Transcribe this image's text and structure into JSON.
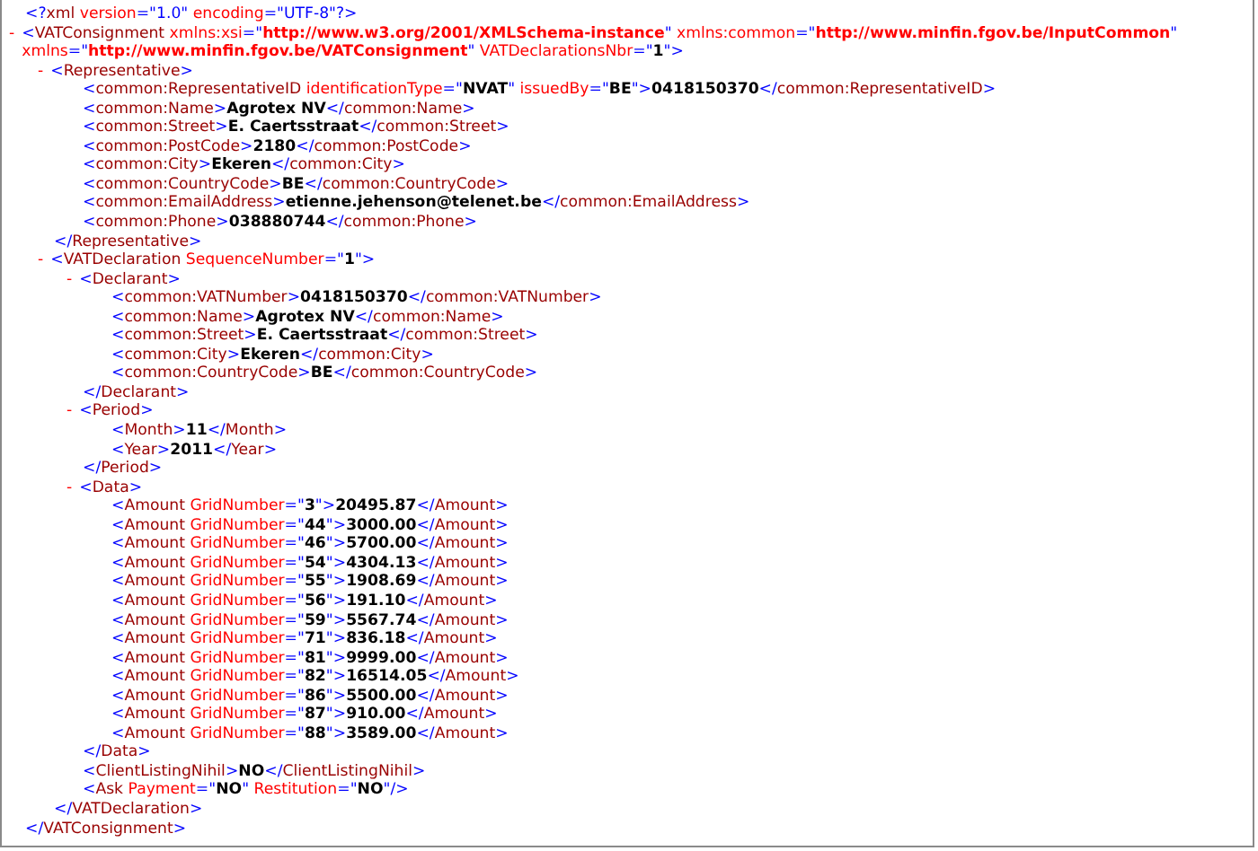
{
  "declaration": [
    {
      "kind": "p",
      "text": "<?"
    },
    {
      "kind": "n",
      "text": "xml"
    },
    {
      "kind": "a",
      "text": " version"
    },
    {
      "kind": "p",
      "text": "=\"1.0\""
    },
    {
      "kind": "a",
      "text": " encoding"
    },
    {
      "kind": "p",
      "text": "=\"UTF-8\"?>"
    }
  ],
  "root": {
    "kind": "branch",
    "toggle": "-",
    "expanded": true,
    "open": [
      {
        "kind": "p",
        "text": "<"
      },
      {
        "kind": "n",
        "text": "VATConsignment"
      },
      {
        "kind": "a",
        "text": " xmlns:xsi"
      },
      {
        "kind": "p",
        "text": "=\""
      },
      {
        "kind": "x",
        "text": "http://www.w3.org/2001/XMLSchema-instance"
      },
      {
        "kind": "p",
        "text": "\""
      },
      {
        "kind": "a",
        "text": " xmlns:common"
      },
      {
        "kind": "p",
        "text": "=\""
      },
      {
        "kind": "x",
        "text": "http://www.minfin.fgov.be/InputCommon"
      },
      {
        "kind": "p",
        "text": "\""
      },
      {
        "kind": "a",
        "text": " xmlns"
      },
      {
        "kind": "p",
        "text": "=\""
      },
      {
        "kind": "x",
        "text": "http://www.minfin.fgov.be/VATConsignment"
      },
      {
        "kind": "p",
        "text": "\""
      },
      {
        "kind": "a",
        "text": " VATDeclarationsNbr"
      },
      {
        "kind": "p",
        "text": "=\""
      },
      {
        "kind": "v",
        "text": "1"
      },
      {
        "kind": "p",
        "text": "\">"
      }
    ],
    "children": [
      {
        "kind": "branch",
        "toggle": "-",
        "expanded": true,
        "open": [
          {
            "kind": "p",
            "text": "<"
          },
          {
            "kind": "n",
            "text": "Representative"
          },
          {
            "kind": "p",
            "text": ">"
          }
        ],
        "children": [
          {
            "kind": "leaf",
            "line": [
              {
                "kind": "p",
                "text": "<"
              },
              {
                "kind": "n",
                "text": "common:RepresentativeID"
              },
              {
                "kind": "a",
                "text": " identificationType"
              },
              {
                "kind": "p",
                "text": "=\""
              },
              {
                "kind": "v",
                "text": "NVAT"
              },
              {
                "kind": "p",
                "text": "\""
              },
              {
                "kind": "a",
                "text": " issuedBy"
              },
              {
                "kind": "p",
                "text": "=\""
              },
              {
                "kind": "v",
                "text": "BE"
              },
              {
                "kind": "p",
                "text": "\">"
              },
              {
                "kind": "t",
                "text": "0418150370"
              },
              {
                "kind": "p",
                "text": "</"
              },
              {
                "kind": "n",
                "text": "common:RepresentativeID"
              },
              {
                "kind": "p",
                "text": ">"
              }
            ]
          },
          {
            "kind": "leaf",
            "line": [
              {
                "kind": "p",
                "text": "<"
              },
              {
                "kind": "n",
                "text": "common:Name"
              },
              {
                "kind": "p",
                "text": ">"
              },
              {
                "kind": "t",
                "text": "Agrotex NV"
              },
              {
                "kind": "p",
                "text": "</"
              },
              {
                "kind": "n",
                "text": "common:Name"
              },
              {
                "kind": "p",
                "text": ">"
              }
            ]
          },
          {
            "kind": "leaf",
            "line": [
              {
                "kind": "p",
                "text": "<"
              },
              {
                "kind": "n",
                "text": "common:Street"
              },
              {
                "kind": "p",
                "text": ">"
              },
              {
                "kind": "t",
                "text": "E. Caertsstraat"
              },
              {
                "kind": "p",
                "text": "</"
              },
              {
                "kind": "n",
                "text": "common:Street"
              },
              {
                "kind": "p",
                "text": ">"
              }
            ]
          },
          {
            "kind": "leaf",
            "line": [
              {
                "kind": "p",
                "text": "<"
              },
              {
                "kind": "n",
                "text": "common:PostCode"
              },
              {
                "kind": "p",
                "text": ">"
              },
              {
                "kind": "t",
                "text": "2180"
              },
              {
                "kind": "p",
                "text": "</"
              },
              {
                "kind": "n",
                "text": "common:PostCode"
              },
              {
                "kind": "p",
                "text": ">"
              }
            ]
          },
          {
            "kind": "leaf",
            "line": [
              {
                "kind": "p",
                "text": "<"
              },
              {
                "kind": "n",
                "text": "common:City"
              },
              {
                "kind": "p",
                "text": ">"
              },
              {
                "kind": "t",
                "text": "Ekeren"
              },
              {
                "kind": "p",
                "text": "</"
              },
              {
                "kind": "n",
                "text": "common:City"
              },
              {
                "kind": "p",
                "text": ">"
              }
            ]
          },
          {
            "kind": "leaf",
            "line": [
              {
                "kind": "p",
                "text": "<"
              },
              {
                "kind": "n",
                "text": "common:CountryCode"
              },
              {
                "kind": "p",
                "text": ">"
              },
              {
                "kind": "t",
                "text": "BE"
              },
              {
                "kind": "p",
                "text": "</"
              },
              {
                "kind": "n",
                "text": "common:CountryCode"
              },
              {
                "kind": "p",
                "text": ">"
              }
            ]
          },
          {
            "kind": "leaf",
            "line": [
              {
                "kind": "p",
                "text": "<"
              },
              {
                "kind": "n",
                "text": "common:EmailAddress"
              },
              {
                "kind": "p",
                "text": ">"
              },
              {
                "kind": "t",
                "text": "etienne.jehenson@telenet.be"
              },
              {
                "kind": "p",
                "text": "</"
              },
              {
                "kind": "n",
                "text": "common:EmailAddress"
              },
              {
                "kind": "p",
                "text": ">"
              }
            ]
          },
          {
            "kind": "leaf",
            "line": [
              {
                "kind": "p",
                "text": "<"
              },
              {
                "kind": "n",
                "text": "common:Phone"
              },
              {
                "kind": "p",
                "text": ">"
              },
              {
                "kind": "t",
                "text": "038880744"
              },
              {
                "kind": "p",
                "text": "</"
              },
              {
                "kind": "n",
                "text": "common:Phone"
              },
              {
                "kind": "p",
                "text": ">"
              }
            ]
          }
        ],
        "close": [
          {
            "kind": "p",
            "text": "</"
          },
          {
            "kind": "n",
            "text": "Representative"
          },
          {
            "kind": "p",
            "text": ">"
          }
        ]
      },
      {
        "kind": "branch",
        "toggle": "-",
        "expanded": true,
        "open": [
          {
            "kind": "p",
            "text": "<"
          },
          {
            "kind": "n",
            "text": "VATDeclaration"
          },
          {
            "kind": "a",
            "text": " SequenceNumber"
          },
          {
            "kind": "p",
            "text": "=\""
          },
          {
            "kind": "v",
            "text": "1"
          },
          {
            "kind": "p",
            "text": "\">"
          }
        ],
        "children": [
          {
            "kind": "branch",
            "toggle": "-",
            "expanded": true,
            "open": [
              {
                "kind": "p",
                "text": "<"
              },
              {
                "kind": "n",
                "text": "Declarant"
              },
              {
                "kind": "p",
                "text": ">"
              }
            ],
            "children": [
              {
                "kind": "leaf",
                "line": [
                  {
                    "kind": "p",
                    "text": "<"
                  },
                  {
                    "kind": "n",
                    "text": "common:VATNumber"
                  },
                  {
                    "kind": "p",
                    "text": ">"
                  },
                  {
                    "kind": "t",
                    "text": "0418150370"
                  },
                  {
                    "kind": "p",
                    "text": "</"
                  },
                  {
                    "kind": "n",
                    "text": "common:VATNumber"
                  },
                  {
                    "kind": "p",
                    "text": ">"
                  }
                ]
              },
              {
                "kind": "leaf",
                "line": [
                  {
                    "kind": "p",
                    "text": "<"
                  },
                  {
                    "kind": "n",
                    "text": "common:Name"
                  },
                  {
                    "kind": "p",
                    "text": ">"
                  },
                  {
                    "kind": "t",
                    "text": "Agrotex NV"
                  },
                  {
                    "kind": "p",
                    "text": "</"
                  },
                  {
                    "kind": "n",
                    "text": "common:Name"
                  },
                  {
                    "kind": "p",
                    "text": ">"
                  }
                ]
              },
              {
                "kind": "leaf",
                "line": [
                  {
                    "kind": "p",
                    "text": "<"
                  },
                  {
                    "kind": "n",
                    "text": "common:Street"
                  },
                  {
                    "kind": "p",
                    "text": ">"
                  },
                  {
                    "kind": "t",
                    "text": "E. Caertsstraat"
                  },
                  {
                    "kind": "p",
                    "text": "</"
                  },
                  {
                    "kind": "n",
                    "text": "common:Street"
                  },
                  {
                    "kind": "p",
                    "text": ">"
                  }
                ]
              },
              {
                "kind": "leaf",
                "line": [
                  {
                    "kind": "p",
                    "text": "<"
                  },
                  {
                    "kind": "n",
                    "text": "common:City"
                  },
                  {
                    "kind": "p",
                    "text": ">"
                  },
                  {
                    "kind": "t",
                    "text": "Ekeren"
                  },
                  {
                    "kind": "p",
                    "text": "</"
                  },
                  {
                    "kind": "n",
                    "text": "common:City"
                  },
                  {
                    "kind": "p",
                    "text": ">"
                  }
                ]
              },
              {
                "kind": "leaf",
                "line": [
                  {
                    "kind": "p",
                    "text": "<"
                  },
                  {
                    "kind": "n",
                    "text": "common:CountryCode"
                  },
                  {
                    "kind": "p",
                    "text": ">"
                  },
                  {
                    "kind": "t",
                    "text": "BE"
                  },
                  {
                    "kind": "p",
                    "text": "</"
                  },
                  {
                    "kind": "n",
                    "text": "common:CountryCode"
                  },
                  {
                    "kind": "p",
                    "text": ">"
                  }
                ]
              }
            ],
            "close": [
              {
                "kind": "p",
                "text": "</"
              },
              {
                "kind": "n",
                "text": "Declarant"
              },
              {
                "kind": "p",
                "text": ">"
              }
            ]
          },
          {
            "kind": "branch",
            "toggle": "-",
            "expanded": true,
            "open": [
              {
                "kind": "p",
                "text": "<"
              },
              {
                "kind": "n",
                "text": "Period"
              },
              {
                "kind": "p",
                "text": ">"
              }
            ],
            "children": [
              {
                "kind": "leaf",
                "line": [
                  {
                    "kind": "p",
                    "text": "<"
                  },
                  {
                    "kind": "n",
                    "text": "Month"
                  },
                  {
                    "kind": "p",
                    "text": ">"
                  },
                  {
                    "kind": "t",
                    "text": "11"
                  },
                  {
                    "kind": "p",
                    "text": "</"
                  },
                  {
                    "kind": "n",
                    "text": "Month"
                  },
                  {
                    "kind": "p",
                    "text": ">"
                  }
                ]
              },
              {
                "kind": "leaf",
                "line": [
                  {
                    "kind": "p",
                    "text": "<"
                  },
                  {
                    "kind": "n",
                    "text": "Year"
                  },
                  {
                    "kind": "p",
                    "text": ">"
                  },
                  {
                    "kind": "t",
                    "text": "2011"
                  },
                  {
                    "kind": "p",
                    "text": "</"
                  },
                  {
                    "kind": "n",
                    "text": "Year"
                  },
                  {
                    "kind": "p",
                    "text": ">"
                  }
                ]
              }
            ],
            "close": [
              {
                "kind": "p",
                "text": "</"
              },
              {
                "kind": "n",
                "text": "Period"
              },
              {
                "kind": "p",
                "text": ">"
              }
            ]
          },
          {
            "kind": "branch",
            "toggle": "-",
            "expanded": true,
            "open": [
              {
                "kind": "p",
                "text": "<"
              },
              {
                "kind": "n",
                "text": "Data"
              },
              {
                "kind": "p",
                "text": ">"
              }
            ],
            "children": [
              {
                "kind": "leaf",
                "line": [
                  {
                    "kind": "p",
                    "text": "<"
                  },
                  {
                    "kind": "n",
                    "text": "Amount"
                  },
                  {
                    "kind": "a",
                    "text": " GridNumber"
                  },
                  {
                    "kind": "p",
                    "text": "=\""
                  },
                  {
                    "kind": "v",
                    "text": "3"
                  },
                  {
                    "kind": "p",
                    "text": "\">"
                  },
                  {
                    "kind": "t",
                    "text": "20495.87"
                  },
                  {
                    "kind": "p",
                    "text": "</"
                  },
                  {
                    "kind": "n",
                    "text": "Amount"
                  },
                  {
                    "kind": "p",
                    "text": ">"
                  }
                ]
              },
              {
                "kind": "leaf",
                "line": [
                  {
                    "kind": "p",
                    "text": "<"
                  },
                  {
                    "kind": "n",
                    "text": "Amount"
                  },
                  {
                    "kind": "a",
                    "text": " GridNumber"
                  },
                  {
                    "kind": "p",
                    "text": "=\""
                  },
                  {
                    "kind": "v",
                    "text": "44"
                  },
                  {
                    "kind": "p",
                    "text": "\">"
                  },
                  {
                    "kind": "t",
                    "text": "3000.00"
                  },
                  {
                    "kind": "p",
                    "text": "</"
                  },
                  {
                    "kind": "n",
                    "text": "Amount"
                  },
                  {
                    "kind": "p",
                    "text": ">"
                  }
                ]
              },
              {
                "kind": "leaf",
                "line": [
                  {
                    "kind": "p",
                    "text": "<"
                  },
                  {
                    "kind": "n",
                    "text": "Amount"
                  },
                  {
                    "kind": "a",
                    "text": " GridNumber"
                  },
                  {
                    "kind": "p",
                    "text": "=\""
                  },
                  {
                    "kind": "v",
                    "text": "46"
                  },
                  {
                    "kind": "p",
                    "text": "\">"
                  },
                  {
                    "kind": "t",
                    "text": "5700.00"
                  },
                  {
                    "kind": "p",
                    "text": "</"
                  },
                  {
                    "kind": "n",
                    "text": "Amount"
                  },
                  {
                    "kind": "p",
                    "text": ">"
                  }
                ]
              },
              {
                "kind": "leaf",
                "line": [
                  {
                    "kind": "p",
                    "text": "<"
                  },
                  {
                    "kind": "n",
                    "text": "Amount"
                  },
                  {
                    "kind": "a",
                    "text": " GridNumber"
                  },
                  {
                    "kind": "p",
                    "text": "=\""
                  },
                  {
                    "kind": "v",
                    "text": "54"
                  },
                  {
                    "kind": "p",
                    "text": "\">"
                  },
                  {
                    "kind": "t",
                    "text": "4304.13"
                  },
                  {
                    "kind": "p",
                    "text": "</"
                  },
                  {
                    "kind": "n",
                    "text": "Amount"
                  },
                  {
                    "kind": "p",
                    "text": ">"
                  }
                ]
              },
              {
                "kind": "leaf",
                "line": [
                  {
                    "kind": "p",
                    "text": "<"
                  },
                  {
                    "kind": "n",
                    "text": "Amount"
                  },
                  {
                    "kind": "a",
                    "text": " GridNumber"
                  },
                  {
                    "kind": "p",
                    "text": "=\""
                  },
                  {
                    "kind": "v",
                    "text": "55"
                  },
                  {
                    "kind": "p",
                    "text": "\">"
                  },
                  {
                    "kind": "t",
                    "text": "1908.69"
                  },
                  {
                    "kind": "p",
                    "text": "</"
                  },
                  {
                    "kind": "n",
                    "text": "Amount"
                  },
                  {
                    "kind": "p",
                    "text": ">"
                  }
                ]
              },
              {
                "kind": "leaf",
                "line": [
                  {
                    "kind": "p",
                    "text": "<"
                  },
                  {
                    "kind": "n",
                    "text": "Amount"
                  },
                  {
                    "kind": "a",
                    "text": " GridNumber"
                  },
                  {
                    "kind": "p",
                    "text": "=\""
                  },
                  {
                    "kind": "v",
                    "text": "56"
                  },
                  {
                    "kind": "p",
                    "text": "\">"
                  },
                  {
                    "kind": "t",
                    "text": "191.10"
                  },
                  {
                    "kind": "p",
                    "text": "</"
                  },
                  {
                    "kind": "n",
                    "text": "Amount"
                  },
                  {
                    "kind": "p",
                    "text": ">"
                  }
                ]
              },
              {
                "kind": "leaf",
                "line": [
                  {
                    "kind": "p",
                    "text": "<"
                  },
                  {
                    "kind": "n",
                    "text": "Amount"
                  },
                  {
                    "kind": "a",
                    "text": " GridNumber"
                  },
                  {
                    "kind": "p",
                    "text": "=\""
                  },
                  {
                    "kind": "v",
                    "text": "59"
                  },
                  {
                    "kind": "p",
                    "text": "\">"
                  },
                  {
                    "kind": "t",
                    "text": "5567.74"
                  },
                  {
                    "kind": "p",
                    "text": "</"
                  },
                  {
                    "kind": "n",
                    "text": "Amount"
                  },
                  {
                    "kind": "p",
                    "text": ">"
                  }
                ]
              },
              {
                "kind": "leaf",
                "line": [
                  {
                    "kind": "p",
                    "text": "<"
                  },
                  {
                    "kind": "n",
                    "text": "Amount"
                  },
                  {
                    "kind": "a",
                    "text": " GridNumber"
                  },
                  {
                    "kind": "p",
                    "text": "=\""
                  },
                  {
                    "kind": "v",
                    "text": "71"
                  },
                  {
                    "kind": "p",
                    "text": "\">"
                  },
                  {
                    "kind": "t",
                    "text": "836.18"
                  },
                  {
                    "kind": "p",
                    "text": "</"
                  },
                  {
                    "kind": "n",
                    "text": "Amount"
                  },
                  {
                    "kind": "p",
                    "text": ">"
                  }
                ]
              },
              {
                "kind": "leaf",
                "line": [
                  {
                    "kind": "p",
                    "text": "<"
                  },
                  {
                    "kind": "n",
                    "text": "Amount"
                  },
                  {
                    "kind": "a",
                    "text": " GridNumber"
                  },
                  {
                    "kind": "p",
                    "text": "=\""
                  },
                  {
                    "kind": "v",
                    "text": "81"
                  },
                  {
                    "kind": "p",
                    "text": "\">"
                  },
                  {
                    "kind": "t",
                    "text": "9999.00"
                  },
                  {
                    "kind": "p",
                    "text": "</"
                  },
                  {
                    "kind": "n",
                    "text": "Amount"
                  },
                  {
                    "kind": "p",
                    "text": ">"
                  }
                ]
              },
              {
                "kind": "leaf",
                "line": [
                  {
                    "kind": "p",
                    "text": "<"
                  },
                  {
                    "kind": "n",
                    "text": "Amount"
                  },
                  {
                    "kind": "a",
                    "text": " GridNumber"
                  },
                  {
                    "kind": "p",
                    "text": "=\""
                  },
                  {
                    "kind": "v",
                    "text": "82"
                  },
                  {
                    "kind": "p",
                    "text": "\">"
                  },
                  {
                    "kind": "t",
                    "text": "16514.05"
                  },
                  {
                    "kind": "p",
                    "text": "</"
                  },
                  {
                    "kind": "n",
                    "text": "Amount"
                  },
                  {
                    "kind": "p",
                    "text": ">"
                  }
                ]
              },
              {
                "kind": "leaf",
                "line": [
                  {
                    "kind": "p",
                    "text": "<"
                  },
                  {
                    "kind": "n",
                    "text": "Amount"
                  },
                  {
                    "kind": "a",
                    "text": " GridNumber"
                  },
                  {
                    "kind": "p",
                    "text": "=\""
                  },
                  {
                    "kind": "v",
                    "text": "86"
                  },
                  {
                    "kind": "p",
                    "text": "\">"
                  },
                  {
                    "kind": "t",
                    "text": "5500.00"
                  },
                  {
                    "kind": "p",
                    "text": "</"
                  },
                  {
                    "kind": "n",
                    "text": "Amount"
                  },
                  {
                    "kind": "p",
                    "text": ">"
                  }
                ]
              },
              {
                "kind": "leaf",
                "line": [
                  {
                    "kind": "p",
                    "text": "<"
                  },
                  {
                    "kind": "n",
                    "text": "Amount"
                  },
                  {
                    "kind": "a",
                    "text": " GridNumber"
                  },
                  {
                    "kind": "p",
                    "text": "=\""
                  },
                  {
                    "kind": "v",
                    "text": "87"
                  },
                  {
                    "kind": "p",
                    "text": "\">"
                  },
                  {
                    "kind": "t",
                    "text": "910.00"
                  },
                  {
                    "kind": "p",
                    "text": "</"
                  },
                  {
                    "kind": "n",
                    "text": "Amount"
                  },
                  {
                    "kind": "p",
                    "text": ">"
                  }
                ]
              },
              {
                "kind": "leaf",
                "line": [
                  {
                    "kind": "p",
                    "text": "<"
                  },
                  {
                    "kind": "n",
                    "text": "Amount"
                  },
                  {
                    "kind": "a",
                    "text": " GridNumber"
                  },
                  {
                    "kind": "p",
                    "text": "=\""
                  },
                  {
                    "kind": "v",
                    "text": "88"
                  },
                  {
                    "kind": "p",
                    "text": "\">"
                  },
                  {
                    "kind": "t",
                    "text": "3589.00"
                  },
                  {
                    "kind": "p",
                    "text": "</"
                  },
                  {
                    "kind": "n",
                    "text": "Amount"
                  },
                  {
                    "kind": "p",
                    "text": ">"
                  }
                ]
              }
            ],
            "close": [
              {
                "kind": "p",
                "text": "</"
              },
              {
                "kind": "n",
                "text": "Data"
              },
              {
                "kind": "p",
                "text": ">"
              }
            ]
          },
          {
            "kind": "leaf",
            "line": [
              {
                "kind": "p",
                "text": "<"
              },
              {
                "kind": "n",
                "text": "ClientListingNihil"
              },
              {
                "kind": "p",
                "text": ">"
              },
              {
                "kind": "t",
                "text": "NO"
              },
              {
                "kind": "p",
                "text": "</"
              },
              {
                "kind": "n",
                "text": "ClientListingNihil"
              },
              {
                "kind": "p",
                "text": ">"
              }
            ]
          },
          {
            "kind": "leaf",
            "line": [
              {
                "kind": "p",
                "text": "<"
              },
              {
                "kind": "n",
                "text": "Ask"
              },
              {
                "kind": "a",
                "text": " Payment"
              },
              {
                "kind": "p",
                "text": "=\""
              },
              {
                "kind": "v",
                "text": "NO"
              },
              {
                "kind": "p",
                "text": "\""
              },
              {
                "kind": "a",
                "text": " Restitution"
              },
              {
                "kind": "p",
                "text": "=\""
              },
              {
                "kind": "v",
                "text": "NO"
              },
              {
                "kind": "p",
                "text": "\"/>"
              }
            ]
          }
        ],
        "close": [
          {
            "kind": "p",
            "text": "</"
          },
          {
            "kind": "n",
            "text": "VATDeclaration"
          },
          {
            "kind": "p",
            "text": ">"
          }
        ]
      }
    ],
    "close": [
      {
        "kind": "p",
        "text": "</"
      },
      {
        "kind": "n",
        "text": "VATConsignment"
      },
      {
        "kind": "p",
        "text": ">"
      }
    ]
  }
}
